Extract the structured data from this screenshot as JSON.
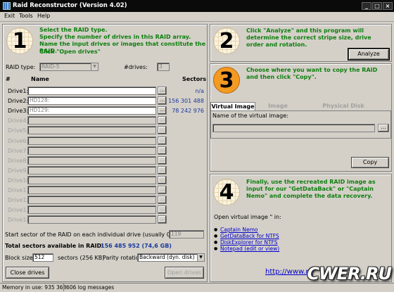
{
  "window": {
    "title": "Raid Reconstructor (Version 4.02)"
  },
  "menu": [
    "Exit",
    "Tools",
    "Help"
  ],
  "step1": {
    "number": "1",
    "lines": [
      "Select the RAID type.",
      "Specify the number of drives in this RAID array.",
      "Name the input drives or images that constitute the RAID.",
      "Click \"Open drives\""
    ],
    "raid_type_label": "RAID type:",
    "raid_type_value": "RAID-5",
    "drives_label": "#drives:",
    "drives_value": "3",
    "col_hash": "#",
    "col_name": "Name",
    "col_sectors": "Sectors",
    "dots": "...",
    "drives": [
      {
        "label": "Drive1:",
        "name": "",
        "sectors": "n/a",
        "enabled": true
      },
      {
        "label": "Drive2:",
        "name": "HD128:",
        "sectors": "156 301 488",
        "enabled": true
      },
      {
        "label": "Drive3:",
        "name": "HD129:",
        "sectors": "78 242 976",
        "enabled": true
      },
      {
        "label": "Drive4:",
        "name": "",
        "sectors": "",
        "enabled": false
      },
      {
        "label": "Drive5:",
        "name": "",
        "sectors": "",
        "enabled": false
      },
      {
        "label": "Drive6:",
        "name": "",
        "sectors": "",
        "enabled": false
      },
      {
        "label": "Drive7:",
        "name": "",
        "sectors": "",
        "enabled": false
      },
      {
        "label": "Drive8:",
        "name": "",
        "sectors": "",
        "enabled": false
      },
      {
        "label": "Drive9:",
        "name": "",
        "sectors": "",
        "enabled": false
      },
      {
        "label": "Drive10:",
        "name": "",
        "sectors": "",
        "enabled": false
      },
      {
        "label": "Drive11:",
        "name": "",
        "sectors": "",
        "enabled": false
      },
      {
        "label": "Drive12:",
        "name": "",
        "sectors": "",
        "enabled": false
      },
      {
        "label": "Drive13:",
        "name": "",
        "sectors": "",
        "enabled": false
      },
      {
        "label": "Drive14:",
        "name": "",
        "sectors": "",
        "enabled": false
      }
    ],
    "start_sector_label": "Start sector of the RAID on each individual drive (usually 0):",
    "start_sector_value": "119",
    "total_label": "Total sectors available in RAID:",
    "total_value": "156 485 952 (74,6 GB)",
    "block_size_label": "Block size:",
    "block_size_value": "512",
    "block_size_unit": "sectors (256 KB)",
    "parity_label": "Parity rotation:",
    "parity_value": "Backward (dyn. disk)",
    "close_button": "Close drives",
    "open_button": "Open drives"
  },
  "step2": {
    "number": "2",
    "text": "Click \"Analyze\" and this program will determine the correct stripe size, drive order and rotation.",
    "analyze_button": "Analyze"
  },
  "step3": {
    "number": "3",
    "text": "Choose where you want to copy the RAID and then click \"Copy\".",
    "tabs": [
      "Virtual Image",
      "Image",
      "Physical Disk"
    ],
    "image_name_label": "Name of the virtual image:",
    "copy_button": "Copy"
  },
  "step4": {
    "number": "4",
    "text": "Finally, use the recreated RAID image as input for our \"GetDataBack\" or \"Captain Nemo\" and complete the data recovery.",
    "open_label": "Open virtual image \" in:",
    "links": [
      "Captain Nemo",
      "GetDataBack for NTFS",
      "DiskExplorer for NTFS",
      "Notepad (edit or view)"
    ],
    "url": "http://www.ru"
  },
  "status": {
    "memory": "Memory in use: 935 368",
    "log": "606 log messages"
  },
  "watermark": "CWER.RU"
}
